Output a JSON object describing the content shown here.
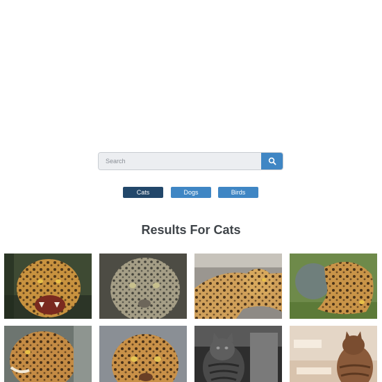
{
  "search": {
    "placeholder": "Search",
    "value": ""
  },
  "icons": {
    "search_button_icon": "magnifier-icon"
  },
  "filters": [
    {
      "label": "Cats",
      "active": true
    },
    {
      "label": "Dogs",
      "active": false
    },
    {
      "label": "Birds",
      "active": false
    }
  ],
  "results": {
    "title": "Results For Cats",
    "images": [
      {
        "subject": "snarling jaguar",
        "tone": "color"
      },
      {
        "subject": "jaguar face close-up",
        "tone": "desaturated"
      },
      {
        "subject": "jaguar lying on rock",
        "tone": "color"
      },
      {
        "subject": "jaguar rolling in grass with ball",
        "tone": "color"
      },
      {
        "subject": "jaguar head profile",
        "tone": "color"
      },
      {
        "subject": "jaguar face portrait",
        "tone": "color"
      },
      {
        "subject": "tabby cat indoors",
        "tone": "grayscale"
      },
      {
        "subject": "cat in sunlight",
        "tone": "color"
      }
    ]
  },
  "colors": {
    "accent": "#3f86c4",
    "active_filter": "#22476a",
    "title_text": "#3f4449"
  }
}
